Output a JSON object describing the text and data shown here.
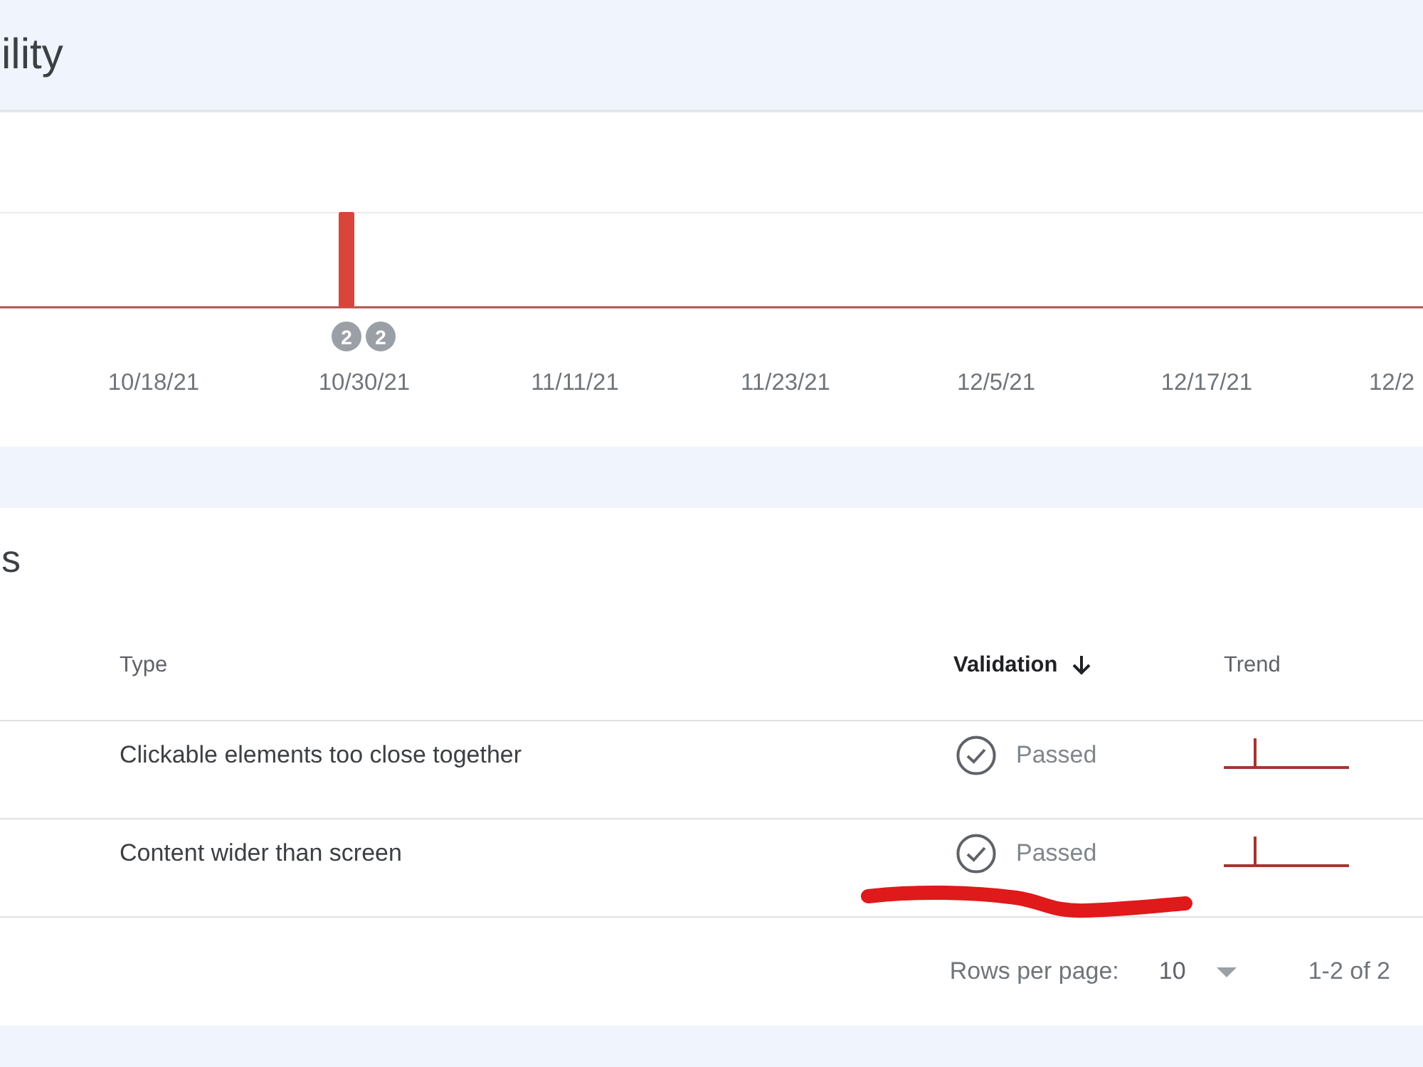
{
  "page": {
    "title": "ility"
  },
  "chart": {
    "x_labels": [
      "10/18/21",
      "10/30/21",
      "11/11/21",
      "11/23/21",
      "12/5/21",
      "12/17/21",
      "12/2"
    ],
    "annotations": [
      {
        "label": "2"
      },
      {
        "label": "2"
      }
    ]
  },
  "table": {
    "title": "s",
    "columns": [
      {
        "label": "Type",
        "sorted": false
      },
      {
        "label": "Validation",
        "sorted": true
      },
      {
        "label": "Trend",
        "sorted": false
      }
    ],
    "rows": [
      {
        "type": "Clickable elements too close together",
        "validation": "Passed"
      },
      {
        "type": "Content wider than screen",
        "validation": "Passed"
      }
    ],
    "footer": {
      "rows_per_page_label": "Rows per page:",
      "rows_per_page": "10",
      "range": "1-2 of 2"
    }
  }
}
